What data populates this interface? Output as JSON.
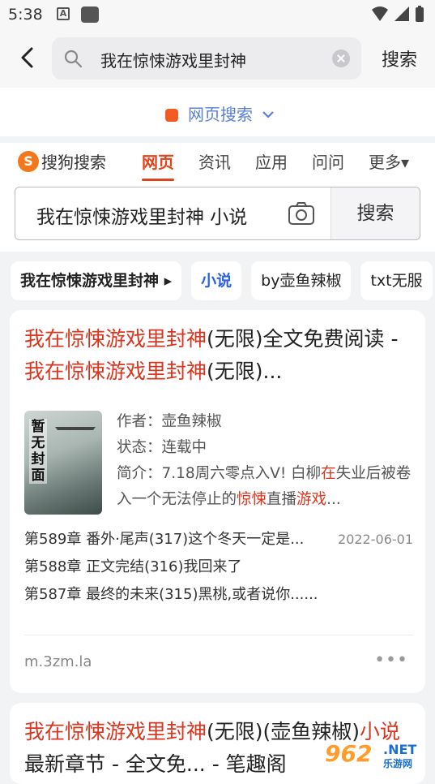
{
  "statusbar": {
    "time": "5:38",
    "a_icon": "A"
  },
  "topbar": {
    "query": "我在惊悚游戏里封神",
    "search_button": "搜索"
  },
  "engine": {
    "label": "网页搜索"
  },
  "sogou": {
    "logo_text": "搜狗搜索",
    "logo_letter": "S",
    "tabs": [
      "网页",
      "资讯",
      "应用",
      "问问",
      "更多▾"
    ],
    "query": "我在惊悚游戏里封神 小说",
    "search_button": "搜索"
  },
  "chips": [
    "我在惊悚游戏里封神 ▸",
    "小说",
    "by壶鱼辣椒",
    "txt无服"
  ],
  "result1": {
    "title_red1": "我在惊悚游戏里封神",
    "title_mid1": "(无限)全文免费阅读 - ",
    "title_red2": "我在惊悚游戏里封神",
    "title_end": "(无限)...",
    "cover_text": "暂无封面",
    "author_label": "作者：",
    "author": "壶鱼辣椒",
    "status_label": "状态：",
    "status": "连载中",
    "intro_label": "简介：",
    "intro_a": "7.18周六零点入V! 白柳",
    "intro_hl1": "在",
    "intro_b": "失业后被卷入一个无法停止的",
    "intro_hl2": "惊悚",
    "intro_c": "直播",
    "intro_hl3": "游戏",
    "intro_d": "...",
    "chapters": [
      {
        "text": "第589章 番外·尾声(317)这个冬天一定是...",
        "date": "2022-06-01"
      },
      {
        "text": "第588章 正文完结(316)我回来了",
        "date": ""
      },
      {
        "text": "第587章 最终的未来(315)黑桃,或者说你......",
        "date": ""
      }
    ],
    "url": "m.3zm.la",
    "more": "•••"
  },
  "result2": {
    "title_red1": "我在惊悚游戏里封神",
    "title_mid": "(无限)(壶鱼辣椒)",
    "title_red2": "小说",
    "title_end": "最新章节 - 全文免... - 笔趣阁"
  },
  "watermark": {
    "num": "962",
    "net": ".NET",
    "site": "乐游网"
  },
  "colors": {
    "accent_red": "#d9351f",
    "accent_blue": "#2b62d9",
    "sogou_orange": "#f5771c"
  }
}
